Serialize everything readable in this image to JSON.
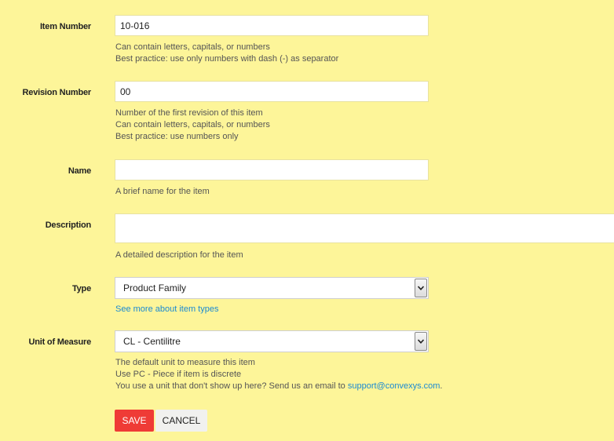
{
  "form": {
    "item_number": {
      "label": "Item Number",
      "value": "10-016",
      "help": [
        "Can contain letters, capitals, or numbers",
        "Best practice: use only numbers with dash (-) as separator"
      ]
    },
    "revision_number": {
      "label": "Revision Number",
      "value": "00",
      "help": [
        "Number of the first revision of this item",
        "Can contain letters, capitals, or numbers",
        "Best practice: use numbers only"
      ]
    },
    "name": {
      "label": "Name",
      "value": "",
      "help": [
        "A brief name for the item"
      ]
    },
    "description": {
      "label": "Description",
      "value": "",
      "help": [
        "A detailed description for the item"
      ]
    },
    "type": {
      "label": "Type",
      "selected": "Product Family",
      "link": "See more about item types"
    },
    "unit_of_measure": {
      "label": "Unit of Measure",
      "selected": "CL - Centilitre",
      "help": [
        "The default unit to measure this item",
        "Use PC - Piece if item is discrete"
      ],
      "email_prefix": "You use a unit that don't show up here? Send us an email to ",
      "email": "support@convexys.com",
      "email_suffix": "."
    }
  },
  "actions": {
    "save_label": "SAVE",
    "cancel_label": "CANCEL"
  },
  "icons": {
    "dropdown": "chevron-down-icon"
  },
  "colors": {
    "background": "#fdf599",
    "save_button": "#ef3b36",
    "link": "#1a8ad2"
  }
}
